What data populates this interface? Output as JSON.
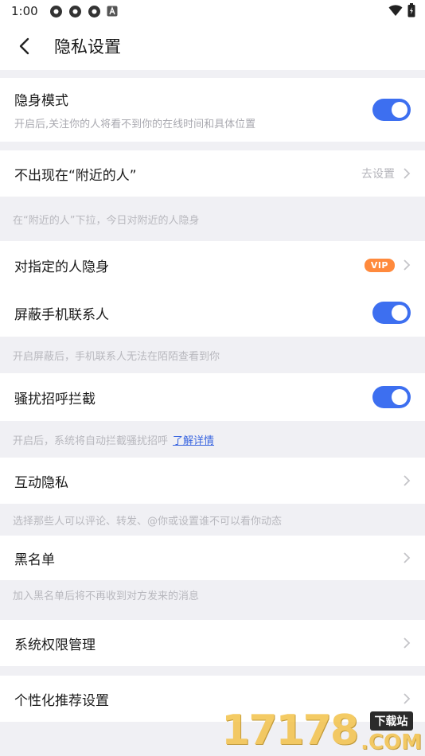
{
  "status": {
    "time": "1:00"
  },
  "header": {
    "title": "隐私设置"
  },
  "rows": {
    "stealth": {
      "title": "隐身模式",
      "subtitle": "开启后,关注你的人将看不到你的在线时间和具体位置"
    },
    "nearby": {
      "title": "不出现在“附近的人”",
      "hint": "去设置",
      "note": "在“附近的人”下拉，今日对附近的人隐身"
    },
    "specific": {
      "title": "对指定的人隐身",
      "badge": "VIP"
    },
    "contacts": {
      "title": "屏蔽手机联系人",
      "note": "开启屏蔽后，手机联系人无法在陌陌查看到你"
    },
    "harass": {
      "title": "骚扰招呼拦截",
      "note": "开启后，系统将自动拦截骚扰招呼",
      "link": "了解详情"
    },
    "interact": {
      "title": "互动隐私",
      "note": "选择那些人可以评论、转发、@你或设置谁不可以看你动态"
    },
    "blacklist": {
      "title": "黑名单",
      "note": "加入黑名单后将不再收到对方发来的消息"
    },
    "permissions": {
      "title": "系统权限管理"
    },
    "recommend": {
      "title": "个性化推荐设置"
    }
  },
  "toggles": {
    "stealth": true,
    "contacts": true,
    "harass": true
  },
  "watermark": {
    "number": "17178",
    "tag": "下载站",
    "suffix": ".COM"
  },
  "colors": {
    "accent": "#3d6ff0",
    "vip": "#ff8a3d",
    "link": "#3a66e0"
  }
}
